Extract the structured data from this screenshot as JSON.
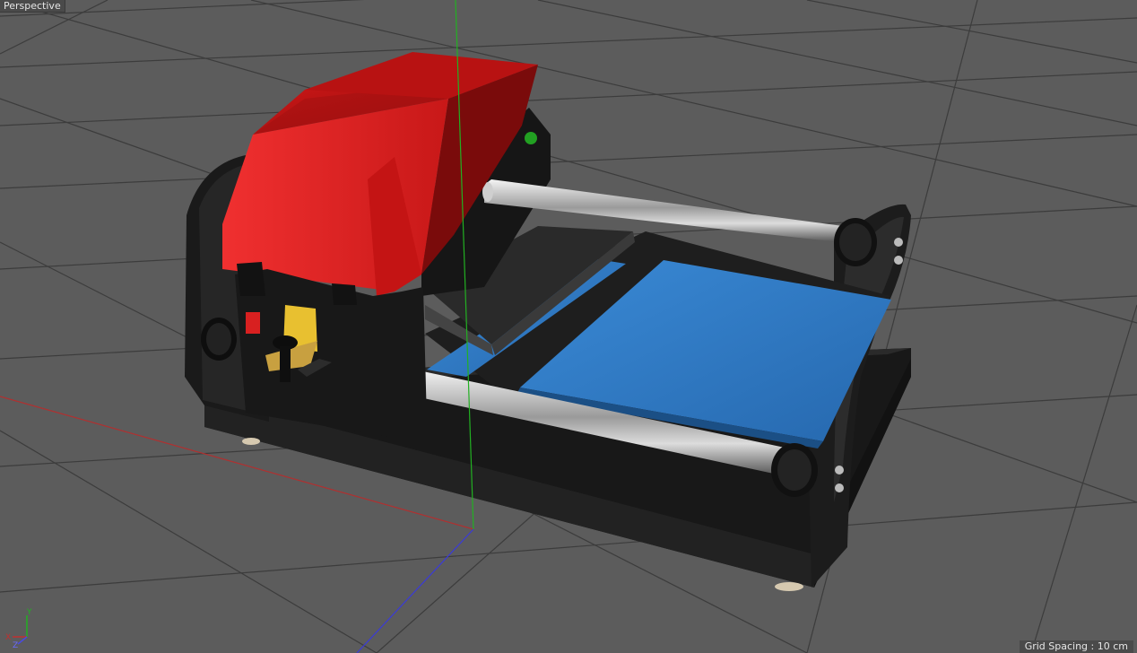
{
  "viewport": {
    "view_name": "Perspective",
    "grid_spacing_text": "Grid Spacing : 10 cm"
  },
  "axis_gizmo": {
    "x_label": "X",
    "y_label": "Y",
    "z_label": "Z"
  },
  "colors": {
    "background": "#5c5c5c",
    "grid_line": "#3c3c3c",
    "axis_x": "#b03030",
    "axis_y": "#22b022",
    "axis_z": "#3a3ad8",
    "hood_red": "#e82020",
    "platen_blue": "#2e78c2",
    "frame_black": "#1c1c1c",
    "label_yellow": "#e8c030"
  }
}
